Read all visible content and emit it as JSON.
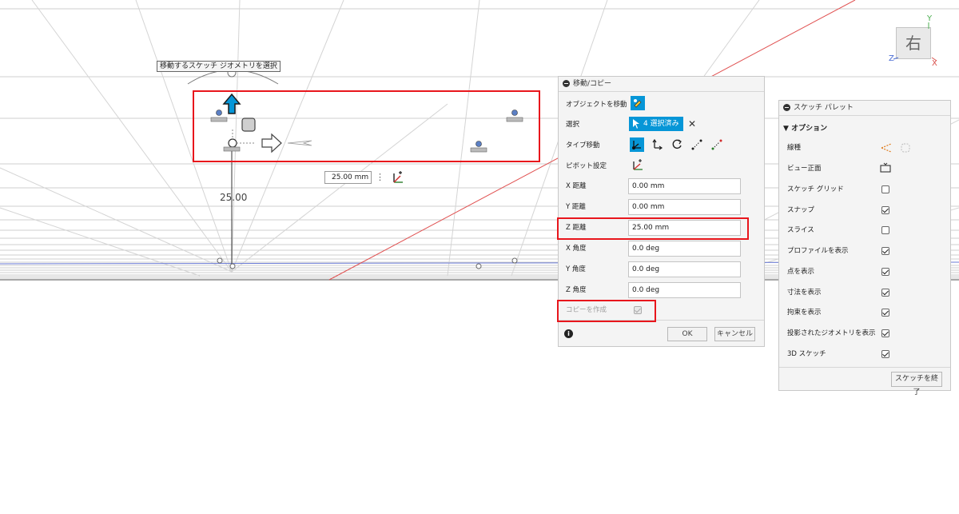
{
  "viewport": {
    "tooltip": "移動するスケッチ ジオメトリを選択",
    "dimension_text": "25.00",
    "value_input": "25.00 mm",
    "viewcube": {
      "face_label": "右",
      "axis_y": "Y",
      "axis_z": "Z",
      "axis_x": "X"
    }
  },
  "move_copy_dialog": {
    "title": "移動/コピー",
    "object_to_move_label": "オブジェクトを移動",
    "selection_label": "選択",
    "selection_button": "4 選択済み",
    "move_type_label": "タイプ移動",
    "pivot_label": "ピボット設定",
    "fields": [
      {
        "label": "X 距離",
        "value": "0.00 mm"
      },
      {
        "label": "Y 距離",
        "value": "0.00 mm"
      },
      {
        "label": "Z 距離",
        "value": "25.00 mm"
      },
      {
        "label": "X 角度",
        "value": "0.0 deg"
      },
      {
        "label": "Y 角度",
        "value": "0.0 deg"
      },
      {
        "label": "Z 角度",
        "value": "0.0 deg"
      }
    ],
    "create_copy_label": "コピーを作成",
    "create_copy_checked": true,
    "ok_button": "OK",
    "cancel_button": "キャンセル"
  },
  "sketch_palette": {
    "title": "スケッチ パレット",
    "section": "オプション",
    "line_type_label": "線種",
    "look_at_label": "ビュー正面",
    "options": [
      {
        "label": "スケッチ グリッド",
        "checked": false
      },
      {
        "label": "スナップ",
        "checked": true
      },
      {
        "label": "スライス",
        "checked": false
      },
      {
        "label": "プロファイルを表示",
        "checked": true
      },
      {
        "label": "点を表示",
        "checked": true
      },
      {
        "label": "寸法を表示",
        "checked": true
      },
      {
        "label": "拘束を表示",
        "checked": true
      },
      {
        "label": "投影されたジオメトリを表示",
        "checked": true
      },
      {
        "label": "3D スケッチ",
        "checked": true
      }
    ],
    "finish_button": "スケッチを終了"
  },
  "colors": {
    "accent_blue": "#0696d7",
    "highlight_red": "#e8161c",
    "grid_gray": "#bfbfbf"
  }
}
